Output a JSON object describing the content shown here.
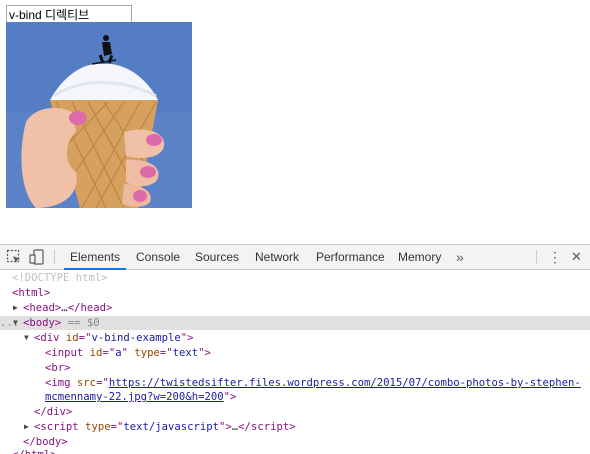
{
  "page": {
    "input_value": "v-bind 디렉티브"
  },
  "devtools": {
    "tabs": [
      {
        "label": "Elements",
        "active": true
      },
      {
        "label": "Console"
      },
      {
        "label": "Sources"
      },
      {
        "label": "Network"
      },
      {
        "label": "Performance"
      },
      {
        "label": "Memory"
      }
    ],
    "more_tabs": "»",
    "menu_icon": "⋮",
    "close_icon": "✕",
    "icons": [
      "inspect-element-icon",
      "device-toolbar-icon",
      "kebab-menu-icon",
      "close-icon"
    ],
    "accent_color": "#1a73e8",
    "tree": {
      "doctype": "<!DOCTYPE html>",
      "html_open": "html",
      "head": "head",
      "head_ellipsis": "…",
      "body": "body",
      "body_eq": "== $0",
      "div": "div",
      "div_id_name": "id",
      "div_id_value": "v-bind-example",
      "input": "input",
      "input_id_name": "id",
      "input_id_value": "a",
      "input_type_name": "type",
      "input_type_value": "text",
      "br": "br",
      "img": "img",
      "img_src_name": "src",
      "img_src_line1": "https://twistedsifter.files.wordpress.com/2015/07/combo-photos-by-stephen-",
      "img_src_line2": "mcmennamy-22.jpg?w=200&h=200",
      "div_close": "div",
      "script": "script",
      "script_type_name": "type",
      "script_type_value": "text/javascript",
      "script_ellipsis": "…",
      "body_close": "body",
      "html_close": "html",
      "left_dots": "..."
    }
  }
}
